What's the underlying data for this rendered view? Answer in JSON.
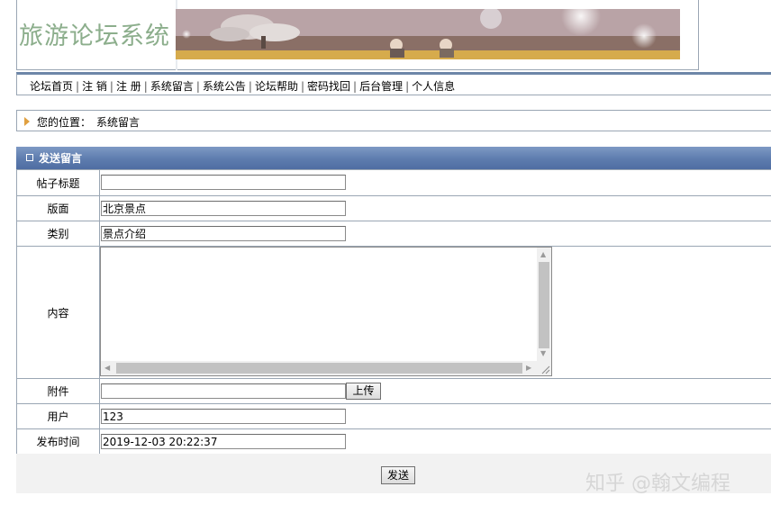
{
  "header": {
    "site_title": "旅游论坛系统"
  },
  "nav": {
    "items": [
      "论坛首页",
      "注 销",
      "注 册",
      "系统留言",
      "系统公告",
      "论坛帮助",
      "密码找回",
      "后台管理",
      "个人信息"
    ],
    "separator": "|"
  },
  "breadcrumb": {
    "label": "您的位置：",
    "current": "系统留言"
  },
  "section": {
    "title": "发送留言"
  },
  "form": {
    "title_label": "帖子标题",
    "title_value": "",
    "board_label": "版面",
    "board_value": "北京景点",
    "category_label": "类别",
    "category_value": "景点介绍",
    "content_label": "内容",
    "content_value": "",
    "attachment_label": "附件",
    "attachment_value": "",
    "upload_label": "上传",
    "user_label": "用户",
    "user_value": "123",
    "time_label": "发布时间",
    "time_value": "2019-12-03 20:22:37",
    "submit_label": "发送"
  },
  "watermark": "知乎 @翰文编程",
  "colors": {
    "nav_border": "#6d86a8",
    "section_header": "#5d7cae",
    "site_title": "#8cae8c",
    "breadcrumb_arrow": "#e0a040"
  }
}
